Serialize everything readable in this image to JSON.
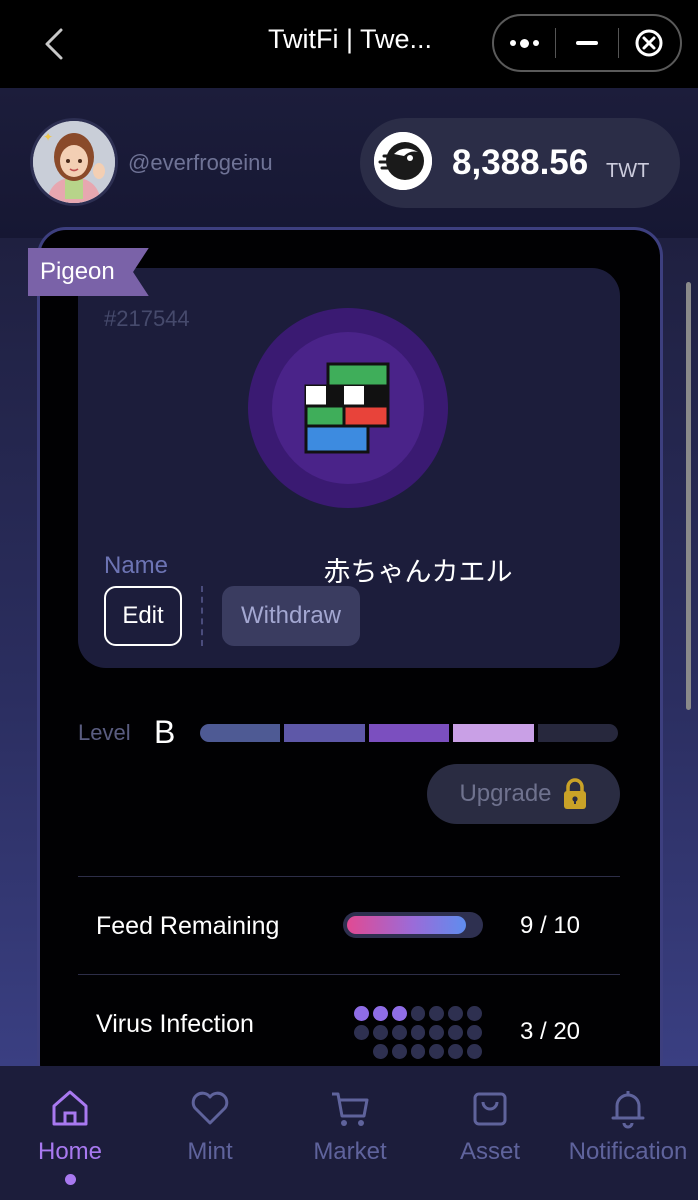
{
  "topbar": {
    "title": "TwitFi | Twe...",
    "back_icon": "chevron-left-icon",
    "menu_icon": "more-dots-icon",
    "minimize_icon": "minus-icon",
    "close_icon": "close-circle-icon"
  },
  "user": {
    "handle": "@everfrogeinu",
    "balance": "8,388.56",
    "currency": "TWT"
  },
  "nft": {
    "rarity_tag": "Pigeon",
    "id": "#217544",
    "name_label": "Name",
    "name": "赤ちゃんカエル",
    "edit_label": "Edit",
    "withdraw_label": "Withdraw"
  },
  "level": {
    "label": "Level",
    "grade": "B",
    "segments_filled": 4,
    "segments_total": 5,
    "segment_colors": [
      "#4e5a94",
      "#5e58a8",
      "#7b4fbf",
      "#c9a0e6",
      "#27283d"
    ],
    "upgrade_label": "Upgrade",
    "upgrade_locked": true
  },
  "stats": {
    "feed": {
      "label": "Feed Remaining",
      "value": "9 / 10",
      "fraction": 0.9
    },
    "virus": {
      "label": "Virus Infection",
      "value": "3 / 20",
      "infected": 3,
      "total": 20
    }
  },
  "nav": {
    "items": [
      {
        "label": "Home",
        "icon": "home-icon",
        "active": true
      },
      {
        "label": "Mint",
        "icon": "heart-icon",
        "active": false
      },
      {
        "label": "Market",
        "icon": "cart-icon",
        "active": false
      },
      {
        "label": "Asset",
        "icon": "bag-icon",
        "active": false
      },
      {
        "label": "Notification",
        "icon": "bell-icon",
        "active": false
      }
    ]
  },
  "colors": {
    "accent": "#a879f0",
    "nav_inactive": "#5f639c",
    "tag_bg": "#7a62a8",
    "orb": "#3a1a72"
  }
}
